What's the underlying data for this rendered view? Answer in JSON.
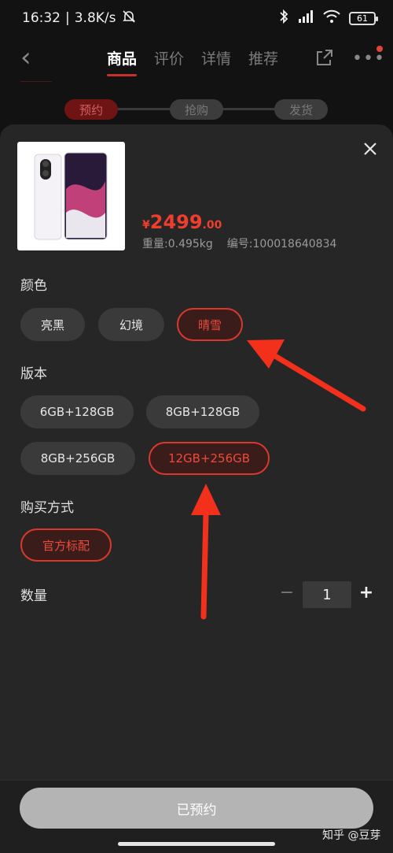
{
  "status_bar": {
    "time": "16:32",
    "speed": "3.8K/s",
    "battery": "61"
  },
  "nav": {
    "tabs": [
      {
        "label": "商品"
      },
      {
        "label": "评价"
      },
      {
        "label": "详情"
      },
      {
        "label": "推荐"
      }
    ]
  },
  "progress": {
    "steps": [
      "预约",
      "抢购",
      "发货"
    ]
  },
  "product": {
    "price_symbol": "¥",
    "price_int": "2499",
    "price_dec": ".00",
    "weight": "重量:0.495kg",
    "sku": "编号:100018640834"
  },
  "color": {
    "label": "颜色",
    "options": [
      "亮黑",
      "幻境",
      "晴雪"
    ],
    "selected": "晴雪"
  },
  "version": {
    "label": "版本",
    "options": [
      "6GB+128GB",
      "8GB+128GB",
      "8GB+256GB",
      "12GB+256GB"
    ],
    "selected": "12GB+256GB"
  },
  "purchase": {
    "label": "购买方式",
    "options": [
      "官方标配"
    ],
    "selected": "官方标配"
  },
  "quantity": {
    "label": "数量",
    "minus": "−",
    "value": "1",
    "plus": "+"
  },
  "action": {
    "button_label": "已预约"
  },
  "watermark": "知乎 @豆芽",
  "colors": {
    "accent": "#ee3e2e",
    "annotation_arrow": "#f2301c"
  }
}
